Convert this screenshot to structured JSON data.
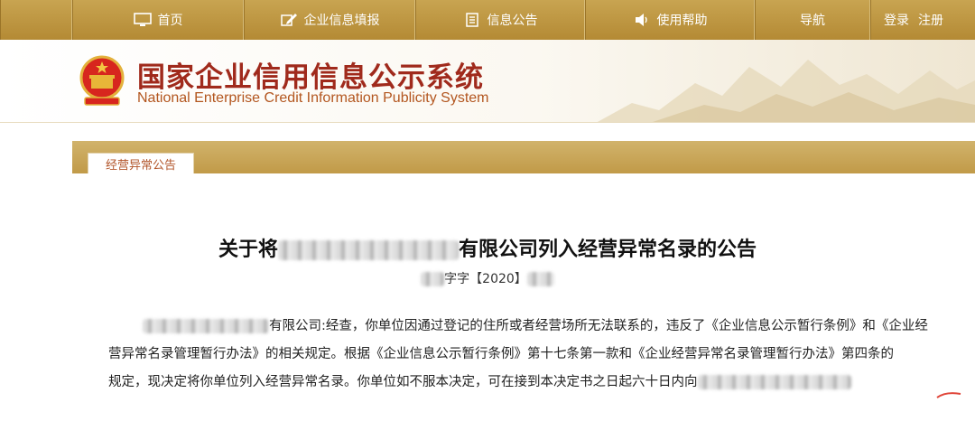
{
  "nav": {
    "home": "首页",
    "fill": "企业信息填报",
    "notice": "信息公告",
    "help": "使用帮助",
    "guide": "导航",
    "login": "登录",
    "register": "注册"
  },
  "header": {
    "title_cn": "国家企业信用信息公示系统",
    "title_en": "National Enterprise Credit Information Publicity System"
  },
  "tab": {
    "label": "经营异常公告"
  },
  "notice": {
    "title_pre": "关于将",
    "title_post": "有限公司列入经营异常名录的公告",
    "doc_no_pre": "字字【2020】",
    "para_line1_post": "有限公司:经查，你单位因通过登记的住所或者经营场所无法联系的，违反了《企业信息公示暂行条例》和《企业经",
    "para_line2": "营异常名录管理暂行办法》的相关规定。根据《企业信息公示暂行条例》第十七条第一款和《企业经营异常名录管理暂行办法》第四条的",
    "para_line3": "规定，现决定将你单位列入经营异常名录。你单位如不服本决定，可在接到本决定书之日起六十日内向"
  },
  "colors": {
    "nav_gold": "#b48a34",
    "title_red": "#a02a1c",
    "tab_text": "#b2552a"
  }
}
